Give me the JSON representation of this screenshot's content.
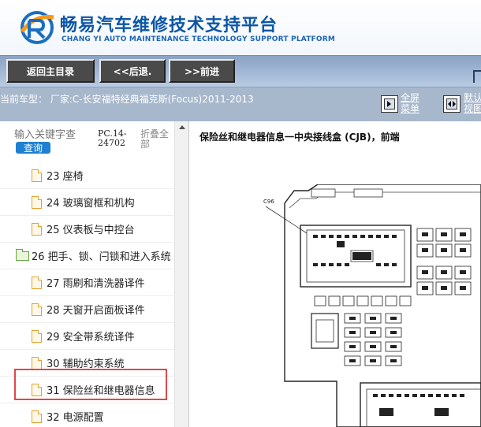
{
  "header": {
    "title": "畅易汽车维修技术支持平台",
    "subtitle": "CHANG YI AUTO MAINTENANCE TECHNOLOGY SUPPORT PLATFORM"
  },
  "nav": {
    "home": "返回主目录",
    "back": "<<后退.",
    "forward": ">>前进"
  },
  "info": {
    "car": "当前车型： 厂家:C-长安福特经典福克斯(Focus)2011-2013",
    "fullscreen_line1": "全屏",
    "fullscreen_line2": "菜单",
    "default_line1": "默认",
    "default_line2": "视图"
  },
  "sidebar": {
    "search_placeholder": "输入关键字查",
    "search_button": "查询",
    "doc_code": "PC.14-24702",
    "collapse": "折叠全部",
    "items": [
      {
        "label": "23 座椅",
        "icon": "file"
      },
      {
        "label": "24 玻璃窗框和机构",
        "icon": "file"
      },
      {
        "label": "25 仪表板与中控台",
        "icon": "file"
      },
      {
        "label": "26 把手、锁、闩锁和进入系统",
        "icon": "folder"
      },
      {
        "label": "27 雨刷和清洗器译件",
        "icon": "file"
      },
      {
        "label": "28 天窗开启面板译件",
        "icon": "file"
      },
      {
        "label": "29 安全带系统译件",
        "icon": "file"
      },
      {
        "label": "30 辅助约束系统",
        "icon": "file"
      },
      {
        "label": "31 保险丝和继电器信息",
        "icon": "file"
      },
      {
        "label": "32 电源配置",
        "icon": "file"
      }
    ]
  },
  "main": {
    "title": "保险丝和继电器信息一中央接线盒 (CJB)，前端",
    "connector_label": "C96"
  }
}
